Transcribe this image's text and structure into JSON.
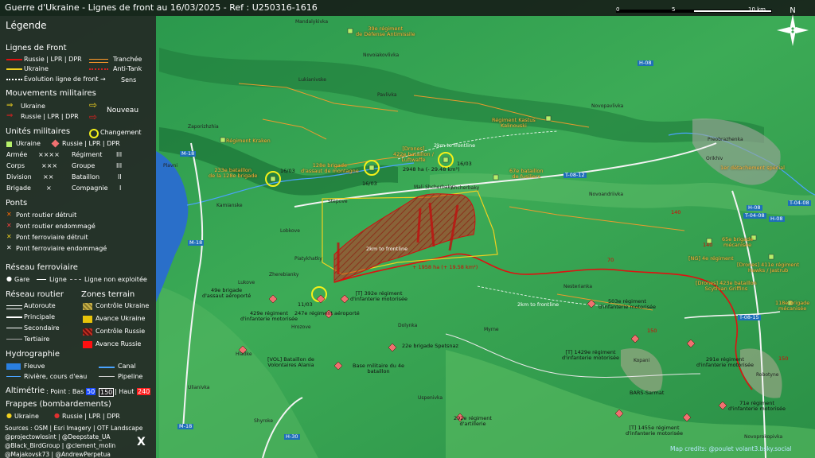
{
  "title": "Guerre d'Ukraine - Lignes de front au 16/03/2025 - Ref : U250316-1616",
  "scale": {
    "ticks": [
      "0",
      "5",
      "10 km"
    ]
  },
  "north_label": "N",
  "legend": {
    "title": "Légende",
    "front_lines": {
      "heading": "Lignes de Front",
      "items": [
        "Russie | LPR | DPR",
        "Ukraine",
        "Évolution ligne de front",
        "Tranchée",
        "Anti-Tank",
        "Sens"
      ]
    },
    "movements": {
      "heading": "Mouvements militaires",
      "items": [
        "Ukraine",
        "Russie | LPR | DPR",
        "Nouveau"
      ]
    },
    "units": {
      "heading": "Unités militaires",
      "change": "Changement",
      "items": [
        "Ukraine",
        "Russie | LPR | DPR"
      ],
      "echelons": [
        [
          "Armée",
          "××××",
          "Régiment",
          "III"
        ],
        [
          "Corps",
          "×××",
          "Groupe",
          "III"
        ],
        [
          "Division",
          "××",
          "Bataillon",
          "II"
        ],
        [
          "Brigade",
          "×",
          "Compagnie",
          "I"
        ]
      ]
    },
    "bridges": {
      "heading": "Ponts",
      "items": [
        "Pont routier détruit",
        "Pont routier endommagé",
        "Pont ferroviaire détruit",
        "Pont ferroviaire endommagé"
      ]
    },
    "rail": {
      "heading": "Réseau ferroviaire",
      "items": [
        "Gare",
        "Ligne",
        "Ligne non exploitée"
      ]
    },
    "roads": {
      "heading": "Réseau routier",
      "items": [
        "Autoroute",
        "Principale",
        "Secondaire",
        "Tertiaire"
      ]
    },
    "zones": {
      "heading": "Zones terrain",
      "items": [
        "Contrôle Ukraine",
        "Avance Ukraine",
        "Contrôle Russie",
        "Avance Russie"
      ]
    },
    "hydro": {
      "heading": "Hydrographie",
      "items": [
        "Fleuve",
        "Canal",
        "Rivière, cours d'eau",
        "Pipeline"
      ]
    },
    "altimetry": {
      "heading": "Altimétrie",
      "text": ": Point : Bas",
      "low": "50",
      "mid": "150",
      "high_label": "| Haut",
      "high": "240"
    },
    "strikes": {
      "heading": "Frappes (bombardements)",
      "items": [
        "Ukraine",
        "Russie | LPR | DPR"
      ]
    },
    "sources": [
      "Sources : OSM | Esri Imagery | OTF Landscape",
      "@projectowlosint | @Deepstate_UA",
      "@Black_BirdGroup | @clement_molin",
      "@Majakovsk73 | @AndrewPerpetua"
    ],
    "x_logo": "X"
  },
  "map": {
    "units_ru": [
      {
        "text": "39e régiment\nde Défense Antimissile"
      },
      {
        "text": "Régiment Kraken"
      },
      {
        "text": "233e bataillon\nde la 128e brigade"
      },
      {
        "text": "128e brigade\nd'assaut de montagne"
      },
      {
        "text": "[Drones]\n422e bataillon /\nLuftwaffe"
      },
      {
        "text": "67e bataillon\nde fusiliers"
      },
      {
        "text": "Régiment Kastus\nKalinouski"
      },
      {
        "text": "1er détachement spécial"
      },
      {
        "text": "65e brigade\nmécanisée"
      },
      {
        "text": "[NG] 4e régiment"
      },
      {
        "text": "[Drones] 411e régiment\nHawks / Jastrub"
      },
      {
        "text": "[Drones] 423e bataillon\nScythian Griffins"
      },
      {
        "text": "118e brigade\nmécanisée"
      }
    ],
    "units_ru_black": [
      {
        "text": "49e brigade\nd'assaut aéroporté"
      },
      {
        "text": "[T] 392e régiment\nd'infanterie motorisée"
      },
      {
        "text": "429e régiment\nd'infanterie motorisée"
      },
      {
        "text": "247e régiment aéroporté"
      },
      {
        "text": "22e brigade Spetsnaz"
      },
      {
        "text": "[VOL] Bataillon de\nVolontaires Alania"
      },
      {
        "text": "Base militaire du 4e\nbataillon"
      },
      {
        "text": "503e régiment\nd'infanterie motorisée"
      },
      {
        "text": "[T] 1429e régiment\nd'infanterie motorisée"
      },
      {
        "text": "291e régiment\nd'infanterie motorisée"
      },
      {
        "text": "BARS-Sarmat"
      },
      {
        "text": "71e régiment\nd'infanterie motorisée"
      },
      {
        "text": "292e régiment\nd'artillerie"
      },
      {
        "text": "[T] 1455e régiment\nd'infanterie motorisée"
      }
    ],
    "dates": [
      "16/03",
      "16/03",
      "16/03",
      "11/03"
    ],
    "drone_alt": "2948 ha (- 29.48 km²)",
    "ru_gain": "+ 1958 ha (+ 19.58 km²)",
    "frontline_labels": [
      "2km to frontline",
      "2km to frontline",
      "2km to frontline"
    ],
    "roads": [
      "M-18",
      "M-18",
      "M-18",
      "H-08",
      "H-08",
      "T-08-12",
      "T-04-08",
      "H-08",
      "T-04-08",
      "T-08-15",
      "H-30"
    ],
    "towns": [
      "Mandalykivka",
      "Novoiakovlivka",
      "Lukianivske",
      "Pavlivka",
      "Zaporizhzhia",
      "Plavni",
      "Kamianske",
      "Stepove",
      "Mali Shcherbaky",
      "Shcherbaky",
      "Lobkove",
      "Piatykhatky",
      "Zherebianky",
      "Lukove",
      "Hrozove",
      "Dolynka",
      "Myrne",
      "Hladke",
      "Nesterianka",
      "Kopani",
      "Robotyne",
      "Orikhiv",
      "Preobrazhenka",
      "Novopavlivka",
      "Novoandriivka",
      "Shyroke",
      "Uspenivka",
      "Ulianivka",
      "Novoprokopivka"
    ],
    "credits": "Map credits: @poulet volant3.bsky.social",
    "elevations": [
      "140",
      "140",
      "150",
      "150",
      "70"
    ]
  }
}
